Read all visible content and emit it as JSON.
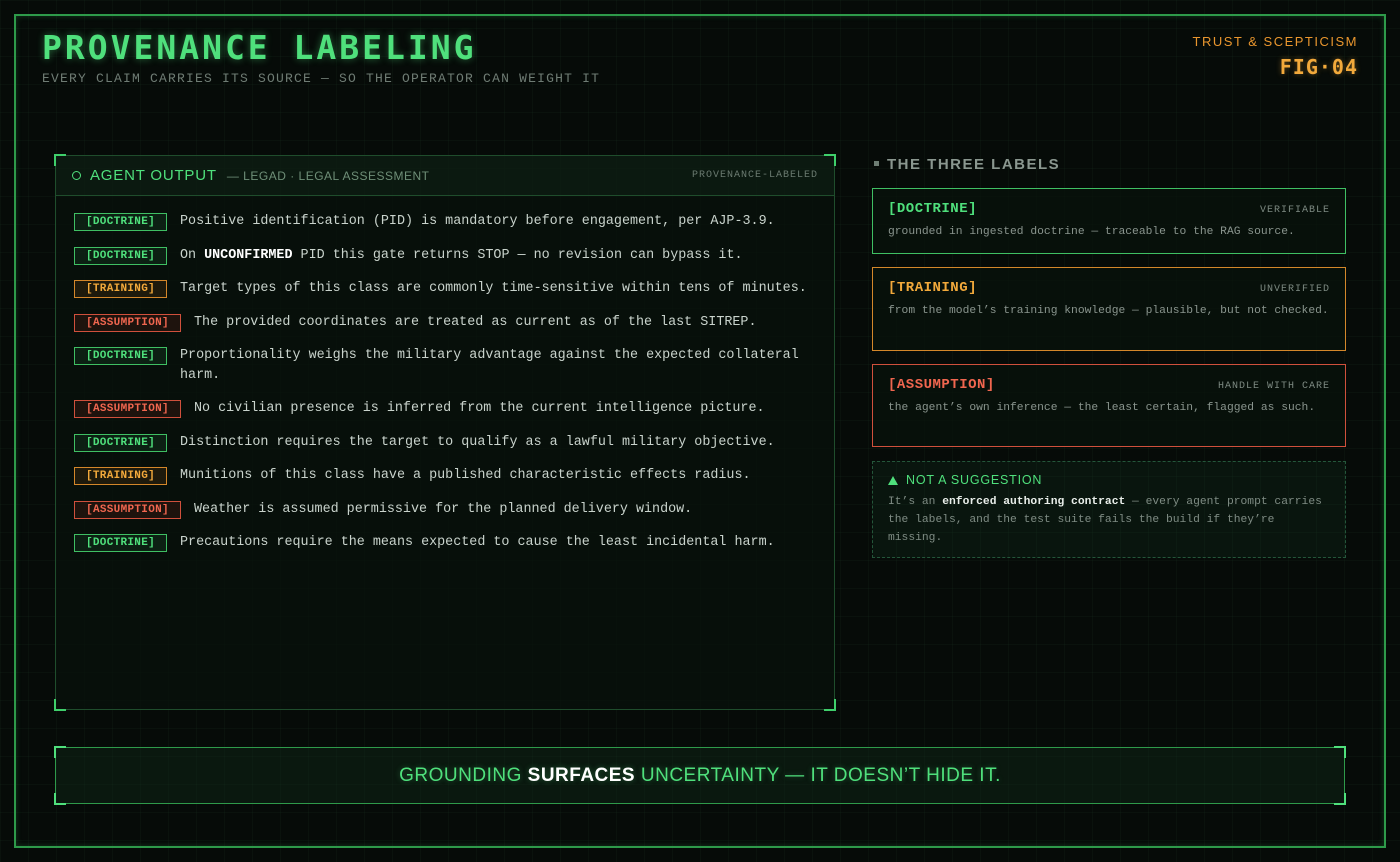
{
  "header": {
    "title": "PROVENANCE LABELING",
    "subtitle": "EVERY CLAIM CARRIES ITS SOURCE — SO THE OPERATOR CAN WEIGHT IT",
    "kicker": "TRUST & SCEPTICISM",
    "figure": "FIG·04"
  },
  "panel": {
    "title": "AGENT OUTPUT",
    "subtitle": "— LEGAD · LEGAL ASSESSMENT",
    "tag": "PROVENANCE-LABELED",
    "claims": [
      {
        "label": "[DOCTRINE]",
        "kind": "doctrine",
        "pre": "Positive identification (PID) is mandatory before engagement, per AJP-3.9.",
        "strong": "",
        "post": ""
      },
      {
        "label": "[DOCTRINE]",
        "kind": "doctrine",
        "pre": "On ",
        "strong": "UNCONFIRMED",
        "post": " PID this gate returns STOP — no revision can bypass it."
      },
      {
        "label": "[TRAINING]",
        "kind": "training",
        "pre": "Target types of this class are commonly time-sensitive within tens of minutes.",
        "strong": "",
        "post": ""
      },
      {
        "label": "[ASSUMPTION]",
        "kind": "assumption",
        "pre": "The provided coordinates are treated as current as of the last SITREP.",
        "strong": "",
        "post": ""
      },
      {
        "label": "[DOCTRINE]",
        "kind": "doctrine",
        "pre": "Proportionality weighs the military advantage against the expected collateral harm.",
        "strong": "",
        "post": ""
      },
      {
        "label": "[ASSUMPTION]",
        "kind": "assumption",
        "pre": "No civilian presence is inferred from the current intelligence picture.",
        "strong": "",
        "post": ""
      },
      {
        "label": "[DOCTRINE]",
        "kind": "doctrine",
        "pre": "Distinction requires the target to qualify as a lawful military objective.",
        "strong": "",
        "post": ""
      },
      {
        "label": "[TRAINING]",
        "kind": "training",
        "pre": "Munitions of this class have a published characteristic effects radius.",
        "strong": "",
        "post": ""
      },
      {
        "label": "[ASSUMPTION]",
        "kind": "assumption",
        "pre": "Weather is assumed permissive for the planned delivery window.",
        "strong": "",
        "post": ""
      },
      {
        "label": "[DOCTRINE]",
        "kind": "doctrine",
        "pre": "Precautions require the means expected to cause the least incidental harm.",
        "strong": "",
        "post": ""
      }
    ]
  },
  "legend": {
    "heading": "THE THREE LABELS",
    "doctrine": {
      "name": "[DOCTRINE]",
      "status": "VERIFIABLE",
      "desc": "grounded in ingested doctrine — traceable to the RAG source."
    },
    "training": {
      "name": "[TRAINING]",
      "status": "UNVERIFIED",
      "desc": "from the model’s training knowledge — plausible, but not checked."
    },
    "assumption": {
      "name": "[ASSUMPTION]",
      "status": "HANDLE WITH CARE",
      "desc": "the agent’s own inference — the least certain, flagged as such."
    }
  },
  "note": {
    "heading": "NOT A SUGGESTION",
    "pre": "It’s an ",
    "strong": "enforced authoring contract",
    "post": " — every agent prompt carries the labels, and the test suite fails the build if they’re missing."
  },
  "banner": {
    "pre": "GROUNDING ",
    "strong": "SURFACES",
    "post": " UNCERTAINTY — IT DOESN’T HIDE IT."
  },
  "colors": {
    "doctrine": "#4fe07c",
    "training": "#f2a93b",
    "assumption": "#f0664f",
    "frame": "#2e9a4a"
  }
}
